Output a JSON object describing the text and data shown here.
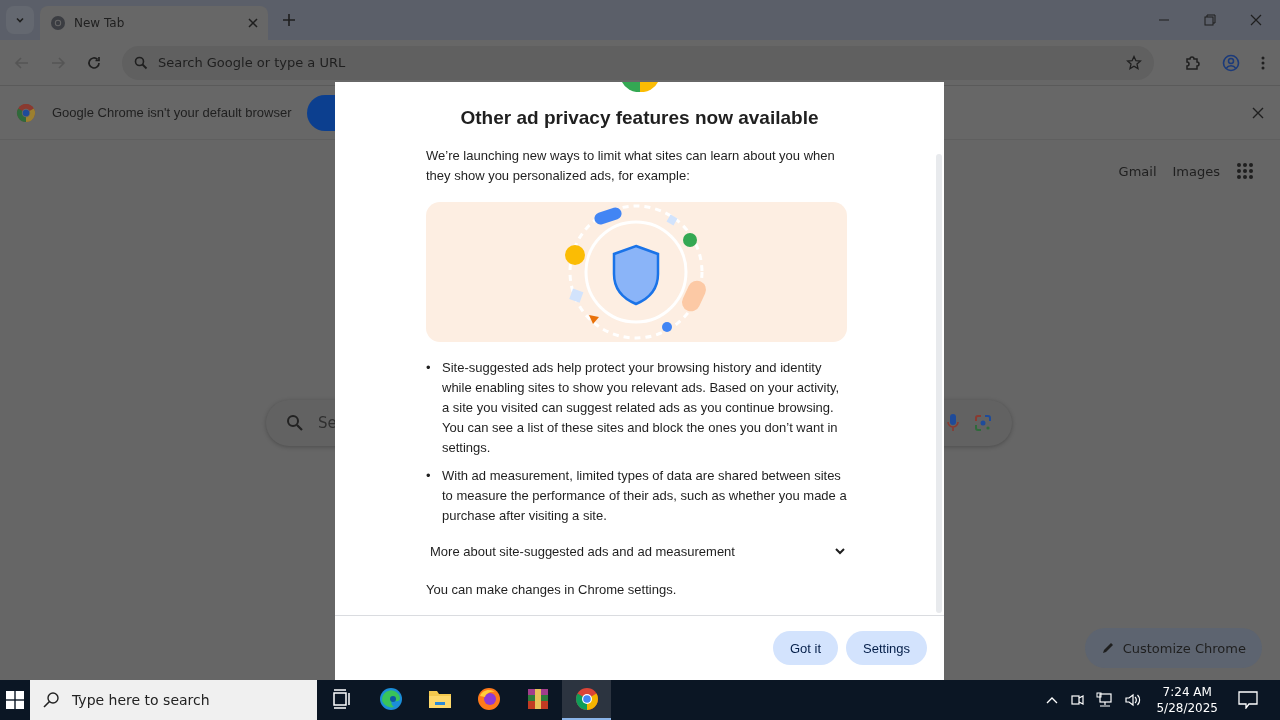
{
  "browser": {
    "tab": {
      "title": "New Tab",
      "selected": true
    },
    "omnibox": {
      "placeholder": "Search Google or type a URL"
    },
    "infobar": {
      "message": "Google Chrome isn't your default browser"
    }
  },
  "new_tab_page": {
    "links": [
      "Gmail",
      "Images"
    ],
    "search": {
      "placeholder": "Se"
    },
    "customize_button": "Customize Chrome"
  },
  "dialog": {
    "title": "Other ad privacy features now available",
    "intro": "We’re launching new ways to limit what sites can learn about you when they show you personalized ads, for example:",
    "bullets": [
      {
        "marker": "•",
        "text": "Site-suggested ads help protect your browsing history and identity while enabling sites to show you relevant ads. Based on your activity, a site you visited can suggest related ads as you continue browsing. You can see a list of these sites and block the ones you don’t want in settings."
      },
      {
        "marker": "•",
        "text": "With ad measurement, limited types of data are shared between sites to measure the performance of their ads, such as whether you made a purchase after visiting a site."
      }
    ],
    "expander": {
      "label": "More about site-suggested ads and ad measurement",
      "expanded": false
    },
    "note": "You can make changes in Chrome settings.",
    "buttons": [
      "Got it",
      "Settings"
    ]
  },
  "taskbar": {
    "search": {
      "placeholder": "Type here to search"
    },
    "apps": [
      {
        "kind": "taskview",
        "selected": false
      },
      {
        "kind": "edge",
        "selected": false
      },
      {
        "kind": "folder",
        "selected": false
      },
      {
        "kind": "firefox",
        "selected": false
      },
      {
        "kind": "archive",
        "selected": false
      },
      {
        "kind": "chrome",
        "selected": true
      }
    ],
    "time": "7:24 AM",
    "date": "5/28/2025"
  }
}
